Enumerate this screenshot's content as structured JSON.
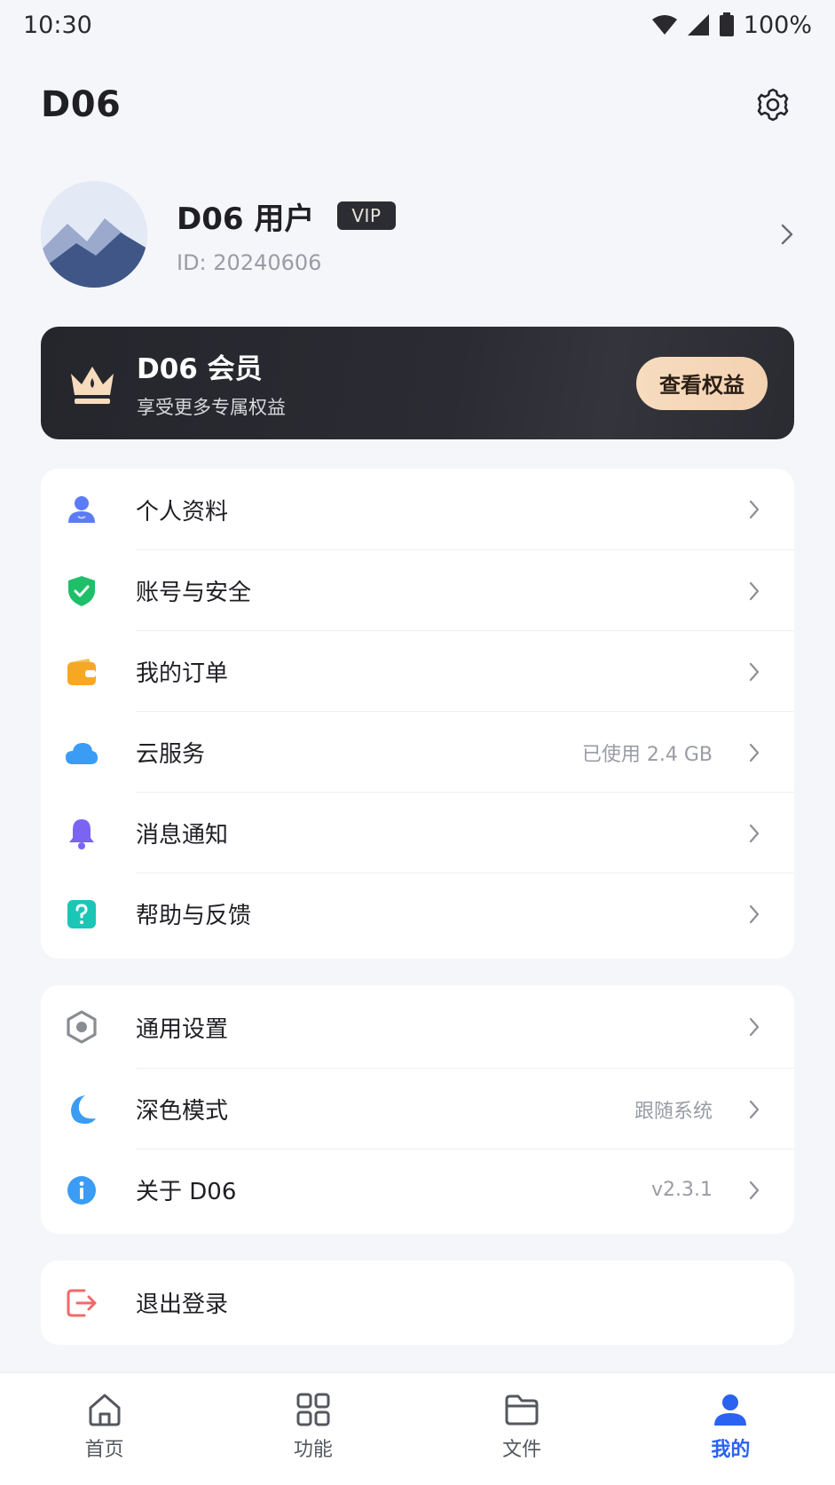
{
  "status": {
    "time": "10:30",
    "battery": "100%"
  },
  "header": {
    "title": "D06"
  },
  "profile": {
    "name": "D06 用户",
    "badge": "VIP",
    "id": "ID: 20240606"
  },
  "vip": {
    "title": "D06 会员",
    "subtitle": "享受更多专属权益",
    "button": "查看权益"
  },
  "menu1": [
    {
      "label": "个人资料",
      "value": "",
      "icon": "user-icon"
    },
    {
      "label": "账号与安全",
      "value": "",
      "icon": "shield-check-icon"
    },
    {
      "label": "我的订单",
      "value": "",
      "icon": "wallet-icon"
    },
    {
      "label": "云服务",
      "value": "已使用 2.4 GB",
      "icon": "cloud-icon"
    },
    {
      "label": "消息通知",
      "value": "",
      "icon": "bell-icon"
    },
    {
      "label": "帮助与反馈",
      "value": "",
      "icon": "help-icon"
    }
  ],
  "menu2": [
    {
      "label": "通用设置",
      "value": "",
      "icon": "settings-hex-icon"
    },
    {
      "label": "深色模式",
      "value": "跟随系统",
      "icon": "moon-icon"
    },
    {
      "label": "关于 D06",
      "value": "v2.3.1",
      "icon": "info-icon"
    }
  ],
  "logout": {
    "label": "退出登录",
    "icon": "logout-icon"
  },
  "tabs": [
    {
      "label": "首页",
      "icon": "home-icon"
    },
    {
      "label": "功能",
      "icon": "grid-icon"
    },
    {
      "label": "文件",
      "icon": "folder-icon"
    },
    {
      "label": "我的",
      "icon": "profile-icon",
      "active": true
    }
  ],
  "colors": {
    "accent": "#2a62f2",
    "vip_bg": "#2a2b31",
    "vip_button": "#f5d7b9"
  }
}
